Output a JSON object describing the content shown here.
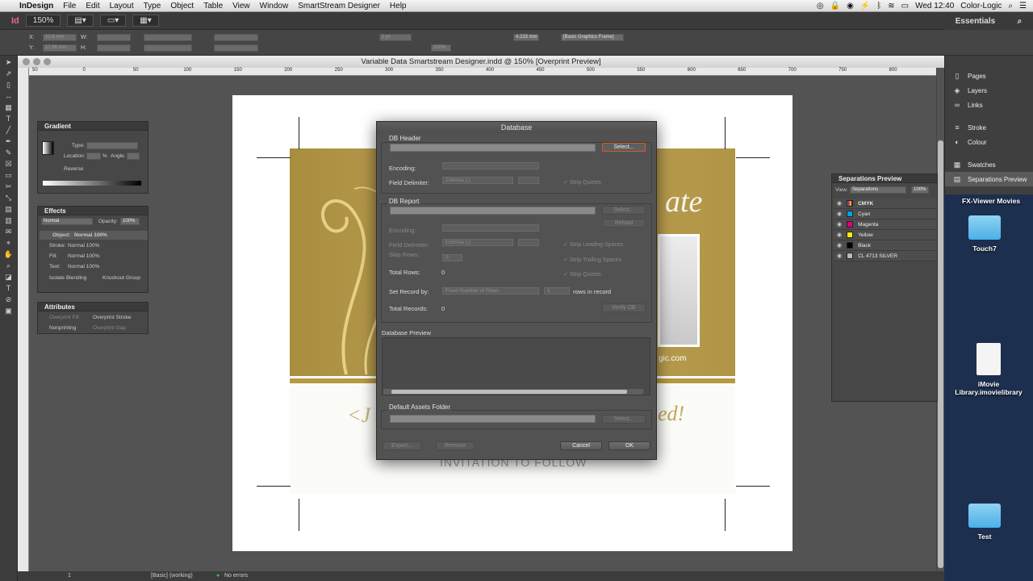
{
  "menubar": {
    "app": "InDesign",
    "items": [
      "File",
      "Edit",
      "Layout",
      "Type",
      "Object",
      "Table",
      "View",
      "Window",
      "SmartStream Designer",
      "Help"
    ],
    "clock": "Wed 12:40",
    "user": "Color-Logic"
  },
  "appbar": {
    "logo": "Id",
    "zoom": "150%",
    "workspace": "Essentials"
  },
  "control": {
    "x_label": "X:",
    "y_label": "Y:",
    "w_label": "W:",
    "h_label": "H:",
    "x_value": "10.8 mm",
    "y_value": "17.66 mm",
    "stroke_weight": "1 pt",
    "zoom_pct": "100%",
    "dimension": "4.233 mm",
    "frame_style": "[Basic Graphics Frame]"
  },
  "document": {
    "title": "Variable Data Smartstream Designer.indd @ 150% [Overprint Preview]",
    "ruler_marks": [
      "50",
      "0",
      "50",
      "100",
      "150",
      "200",
      "250",
      "300",
      "350",
      "400",
      "450",
      "500",
      "550",
      "600",
      "650",
      "700",
      "750",
      "800"
    ],
    "card_text_right": "ate",
    "card_url": "gic.com",
    "cursive_left": "<J",
    "cursive_right": "ed!",
    "invitation": "INVITATION TO FOLLOW"
  },
  "status": {
    "page": "1",
    "style": "[Basic] (working)",
    "preflight": "No errors"
  },
  "gradient_panel": {
    "title": "Gradient",
    "type_label": "Type:",
    "location_label": "Location:",
    "percent": "%",
    "angle_label": "Angle:",
    "reverse_label": "Reverse"
  },
  "effects_panel": {
    "title": "Effects",
    "mode": "Normal",
    "opacity_label": "Opacity:",
    "opacity": "100%",
    "rows": [
      {
        "name": "Object:",
        "value": "Normal 100%"
      },
      {
        "name": "Stroke:",
        "value": "Normal 100%"
      },
      {
        "name": "Fill:",
        "value": "Normal 100%"
      },
      {
        "name": "Text:",
        "value": "Normal 100%"
      }
    ],
    "isolate": "Isolate Blending",
    "knockout": "Knockout Group"
  },
  "attributes_panel": {
    "title": "Attributes",
    "overprint_fill": "Overprint Fill",
    "overprint_stroke": "Overprint Stroke",
    "nonprinting": "Nonprinting",
    "overprint_gap": "Overprint Gap"
  },
  "dock": {
    "items": [
      {
        "label": "Pages",
        "icon": "pages-icon"
      },
      {
        "label": "Layers",
        "icon": "layers-icon"
      },
      {
        "label": "Links",
        "icon": "links-icon"
      },
      {
        "label": "Stroke",
        "icon": "stroke-icon"
      },
      {
        "label": "Colour",
        "icon": "colour-icon"
      },
      {
        "label": "Swatches",
        "icon": "swatches-icon"
      },
      {
        "label": "Separations Preview",
        "icon": "separations-icon"
      }
    ]
  },
  "separations": {
    "title": "Separations Preview",
    "view_label": "View:",
    "view_value": "Separations",
    "zoom": "100%",
    "rows": [
      {
        "name": "CMYK",
        "color": "#cc3366"
      },
      {
        "name": "Cyan",
        "color": "#00a0e0"
      },
      {
        "name": "Magenta",
        "color": "#e0007a"
      },
      {
        "name": "Yellow",
        "color": "#ffee00"
      },
      {
        "name": "Black",
        "color": "#000000"
      },
      {
        "name": "CL 4713 SILVER",
        "color": "#b8b8b8"
      }
    ]
  },
  "desktop": {
    "movies_label": "FX-Viewer Movies",
    "touch7_label": "Touch7",
    "imovie_label": "iMovie Library.imovielibrary",
    "test_label": "Test"
  },
  "dialog": {
    "title": "Database",
    "db_header": "DB Header",
    "select": "Select...",
    "encoding": "Encoding:",
    "field_delimiter": "Field Delimiter:",
    "delimiter_value": "Comma (,)",
    "strip_quotes": "Strip Quotes",
    "db_report": "DB Report",
    "reload": "Reload",
    "strip_leading": "Strip Leading Spaces",
    "strip_trailing": "Strip Trailing Spaces",
    "skip_rows": "Skip Rows:",
    "skip_value": "0",
    "total_rows": "Total Rows:",
    "total_rows_value": "0",
    "set_record_by": "Set Record by:",
    "record_mode": "Fixed Number of Rows",
    "rows_value": "1",
    "rows_in_record": "rows in record",
    "total_records": "Total Records:",
    "total_records_value": "0",
    "verify_db": "Verify DB",
    "database_preview": "Database Preview",
    "default_assets": "Default Assets Folder",
    "export": "Export...",
    "remove": "Remove",
    "cancel": "Cancel",
    "ok": "OK"
  }
}
